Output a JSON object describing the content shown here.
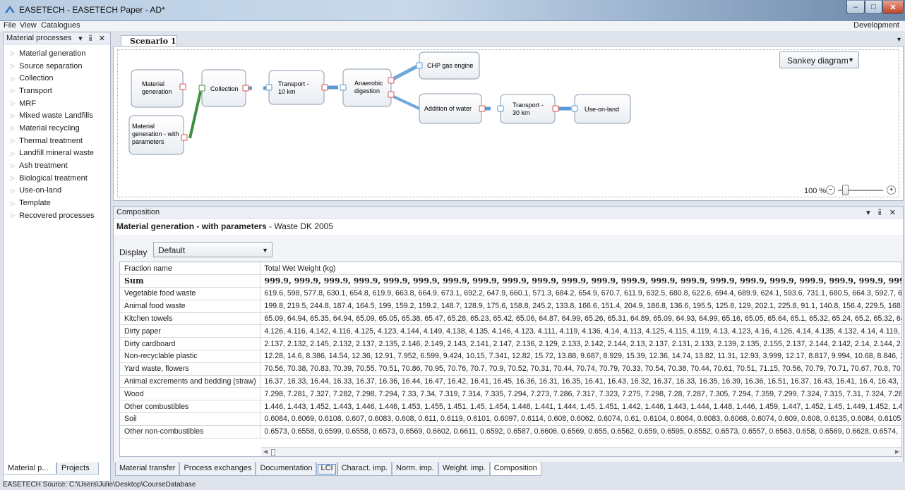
{
  "window": {
    "title": "EASETECH - EASETECH Paper - AD*",
    "min": "–",
    "max": "□",
    "close": "✕"
  },
  "menu": {
    "file": "File",
    "view": "View",
    "catalogues": "Catalogues",
    "right": "Development"
  },
  "left_panel": {
    "title": "Material processes",
    "controls": "▾ ⅱ ✕",
    "items": [
      "Material generation",
      "Source separation",
      "Collection",
      "Transport",
      "MRF",
      "Mixed waste Landfills",
      "Material recycling",
      "Thermal treatment",
      "Landfill mineral waste",
      "Ash treatment",
      "Biological treatment",
      "Use-on-land",
      "Template",
      "Recovered processes"
    ],
    "tabs": [
      "Material p...",
      "Projects"
    ]
  },
  "scenario": {
    "tab": "Scenario 1",
    "view_select": "Sankey diagram",
    "zoom_label": "100 %",
    "zoom_level": 0.15,
    "nodes": {
      "matgen": [
        "Material",
        "generation"
      ],
      "matgen2": [
        "Material",
        "generation - with",
        "parameters"
      ],
      "collection": [
        "Collection"
      ],
      "transport1": [
        "Transport -",
        "10 km"
      ],
      "anaerobic": [
        "Anaerobic",
        "digestion"
      ],
      "chp": [
        "CHP gas engine"
      ],
      "water": [
        "Addition of water"
      ],
      "transport2": [
        "Transport -",
        "30 km"
      ],
      "useonland": [
        "Use-on-land"
      ]
    }
  },
  "composition": {
    "panel_title": "Composition",
    "controls": "▾ ⅱ ✕",
    "subtitle_main": "Material generation - with parameters",
    "subtitle_sep": " - ",
    "subtitle_rest": "Waste DK 2005",
    "display_label": "Display",
    "display_value": "Default",
    "header": [
      "Fraction name",
      "Total Wet Weight (kg)"
    ],
    "sum_label": "Sum",
    "sum_values": "999.9, 999.9, 999.9, 999.9, 999.9, 999.9, 999.9, 999.9, 999.9, 999.9, 999.9, 999.9, 999.9, 999.9, 999.9, 999.9, 999.9, 999.9, 999.9, 999.9, 999.9, 999.9, 999.9, 999.9, 999.9, 999.9, 999",
    "rows": [
      [
        "Vegetable food waste",
        "619.6, 598, 577.8, 630.1, 654.8, 619.9, 663.8, 664.9, 673.1, 692.2, 647.9, 660.1, 571.3, 684.2, 654.9, 670.7, 611.9, 632.5, 680.8, 622.6, 694.4, 689.9, 624.1, 593.6, 731.1, 680.5, 664.3, 592.7, 6"
      ],
      [
        "Animal food waste",
        "199.8, 219.5, 244.8, 187.4, 164.5, 199, 159.2, 159.2, 148.7, 128.9, 175.6, 158.8, 245.2, 133.8, 166.6, 151.4, 204.9, 186.8, 136.6, 195.5, 125.8, 129, 202.1, 225.8, 91.1, 140.8, 156.4, 229.5, 168."
      ],
      [
        "Kitchen towels",
        "65.09, 64.94, 65.35, 64.94, 65.09, 65.05, 65.38, 65.47, 65.28, 65.23, 65.42, 65.06, 64.87, 64.99, 65.26, 65.31, 64.89, 65.09, 64.93, 64.99, 65.16, 65.05, 65.64, 65.1, 65.32, 65.24, 65.2, 65.32, 64"
      ],
      [
        "Dirty paper",
        "4.126, 4.116, 4.142, 4.116, 4.125, 4.123, 4.144, 4.149, 4.138, 4.135, 4.146, 4.123, 4.111, 4.119, 4.136, 4.14, 4.113, 4.125, 4.115, 4.119, 4.13, 4.123, 4.16, 4.126, 4.14, 4.135, 4.132, 4.14, 4.119,"
      ],
      [
        "Dirty cardboard",
        "2.137, 2.132, 2.145, 2.132, 2.137, 2.135, 2.146, 2.149, 2.143, 2.141, 2.147, 2.136, 2.129, 2.133, 2.142, 2.144, 2.13, 2.137, 2.131, 2.133, 2.139, 2.135, 2.155, 2.137, 2.144, 2.142, 2.14, 2.144, 2."
      ],
      [
        "Non-recyclable plastic",
        "12.28, 14.6, 8.386, 14.54, 12.36, 12.91, 7.952, 6.599, 9.424, 10.15, 7.341, 12.82, 15.72, 13.88, 9.687, 8.929, 15.39, 12.36, 14.74, 13.82, 11.31, 12.93, 3.999, 12.17, 8.817, 9.994, 10.68, 8.846, 1"
      ],
      [
        "Yard waste, flowers",
        "70.56, 70.38, 70.83, 70.39, 70.55, 70.51, 70.86, 70.95, 70.76, 70.7, 70.9, 70.52, 70.31, 70.44, 70.74, 70.79, 70.33, 70.54, 70.38, 70.44, 70.61, 70.51, 71.15, 70.56, 70.79, 70.71, 70.67, 70.8, 70."
      ],
      [
        "Animal excrements and bedding (straw)",
        "16.37, 16.33, 16.44, 16.33, 16.37, 16.36, 16.44, 16.47, 16.42, 16.41, 16.45, 16.36, 16.31, 16.35, 16.41, 16.43, 16.32, 16.37, 16.33, 16.35, 16.39, 16.36, 16.51, 16.37, 16.43, 16.41, 16.4, 16.43, 1"
      ],
      [
        "Wood",
        "7.298, 7.281, 7.327, 7.282, 7.298, 7.294, 7.33, 7.34, 7.319, 7.314, 7.335, 7.294, 7.273, 7.286, 7.317, 7.323, 7.275, 7.298, 7.28, 7.287, 7.305, 7.294, 7.359, 7.299, 7.324, 7.315, 7.31, 7.324, 7.28"
      ],
      [
        "Other combustibles",
        "1.446, 1.443, 1.452, 1.443, 1.446, 1.446, 1.453, 1.455, 1.451, 1.45, 1.454, 1.446, 1.441, 1.444, 1.45, 1.451, 1.442, 1.446, 1.443, 1.444, 1.448, 1.446, 1.459, 1.447, 1.452, 1.45, 1.449, 1.452, 1.4"
      ],
      [
        "Soil",
        "0.6084, 0.6069, 0.6108, 0.607, 0.6083, 0.608, 0.611, 0.6119, 0.6101, 0.6097, 0.6114, 0.608, 0.6062, 0.6074, 0.61, 0.6104, 0.6064, 0.6083, 0.6068, 0.6074, 0.609, 0.608, 0.6135, 0.6084, 0.6105"
      ],
      [
        "Other non-combustibles",
        "0.6573, 0.6558, 0.6599, 0.6558, 0.6573, 0.6569, 0.6602, 0.6611, 0.6592, 0.6587, 0.6606, 0.6569, 0.655, 0.6562, 0.659, 0.6595, 0.6552, 0.6573, 0.6557, 0.6563, 0.658, 0.6569, 0.6628, 0.6574,"
      ]
    ]
  },
  "bottom_tabs": [
    "Material transfer",
    "Process exchanges",
    "Documentation",
    "LCI",
    "Charact. imp.",
    "Norm. imp.",
    "Weight. imp.",
    "Composition"
  ],
  "status": "EASETECH Source: C:\\Users\\Julie\\Desktop\\CourseDatabase",
  "colors": {
    "flow": "#5b9bd5",
    "flow_green": "#3f8f3f",
    "node_border": "#8a99ae",
    "port": "#d9534f"
  }
}
